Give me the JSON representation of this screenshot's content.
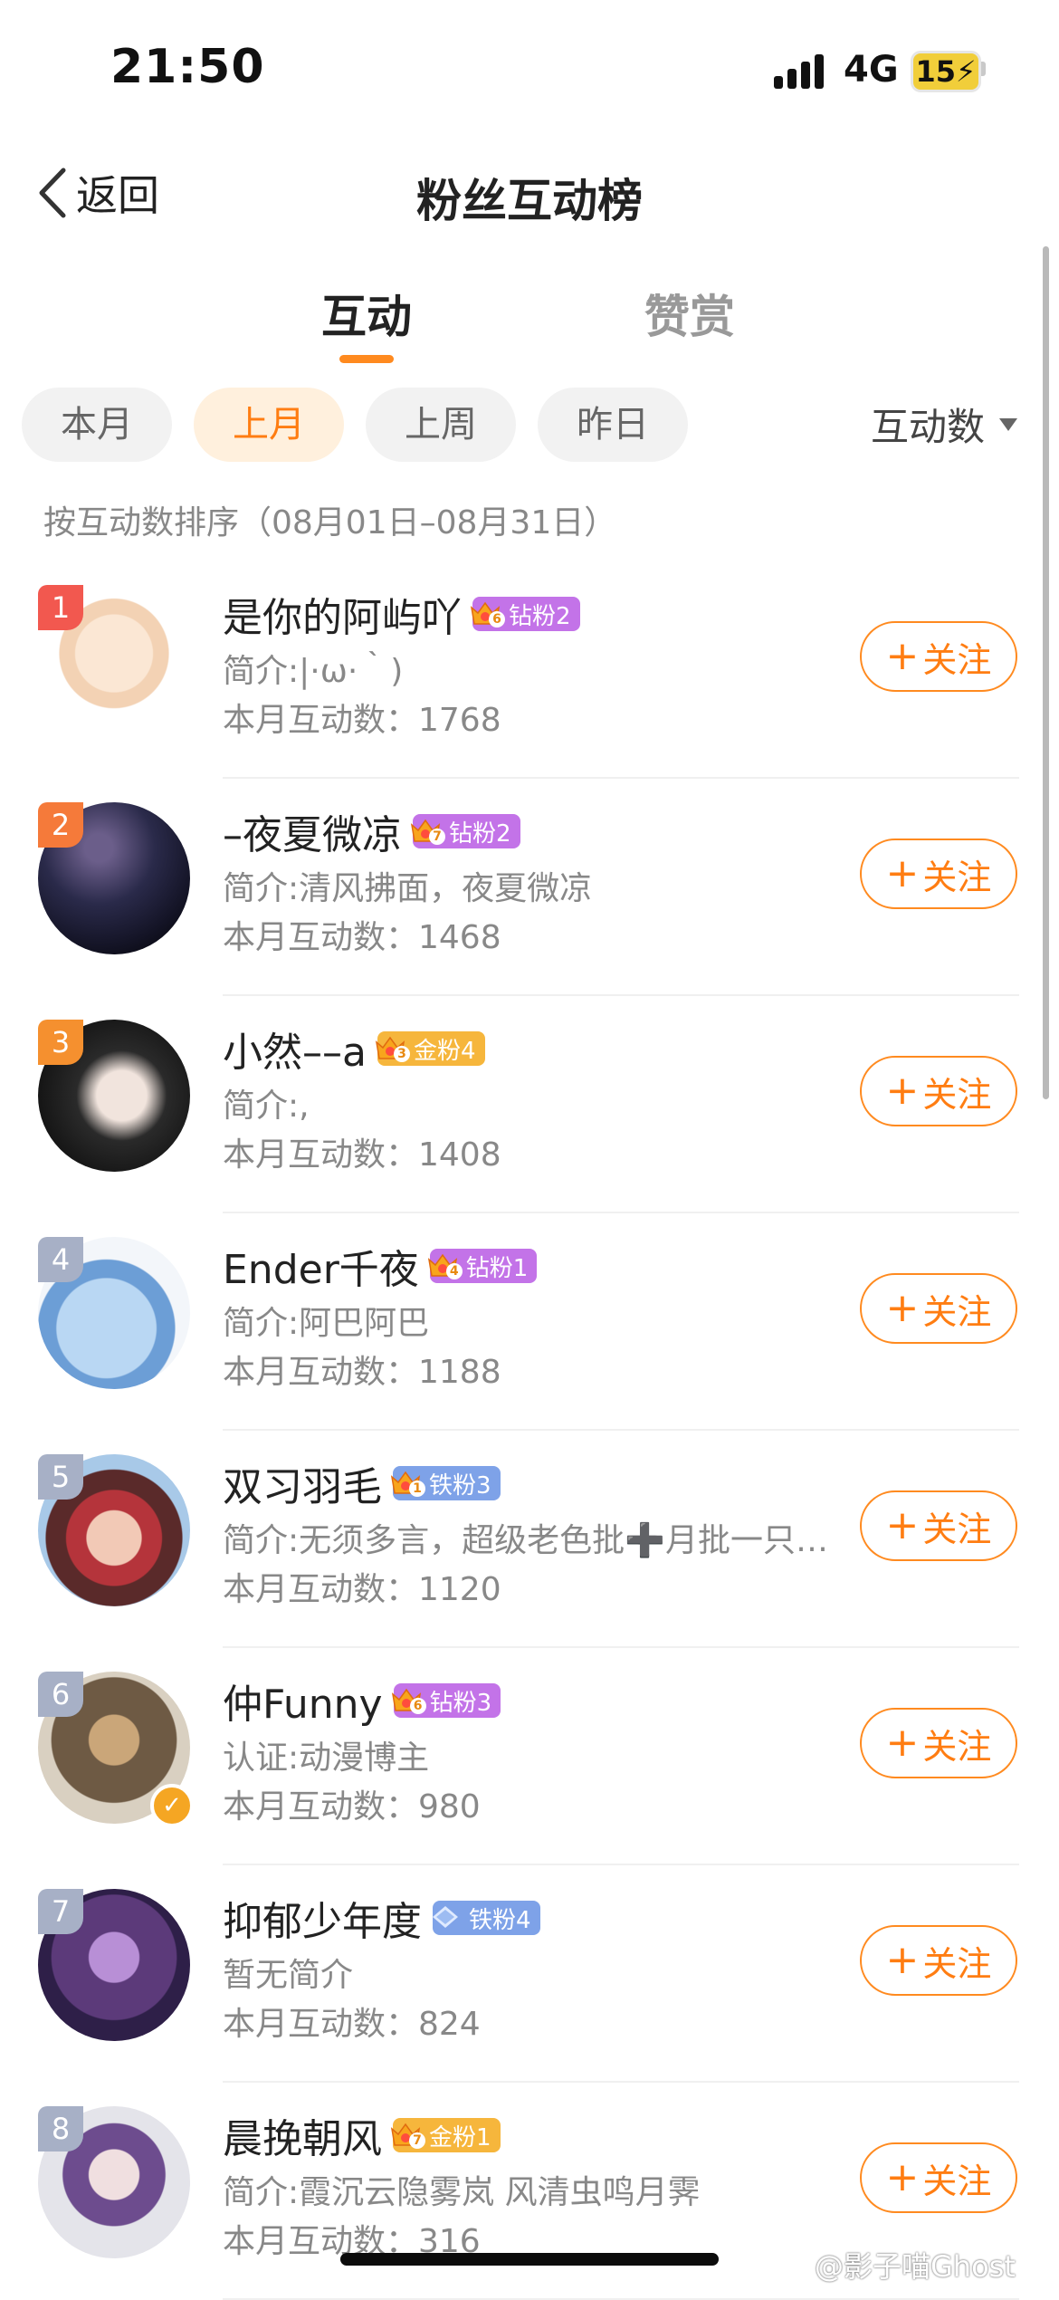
{
  "status_bar": {
    "time": "21:50",
    "network": "4G",
    "battery": "15"
  },
  "nav": {
    "back_label": "返回",
    "title": "粉丝互动榜"
  },
  "tabs": [
    {
      "label": "互动",
      "active": true
    },
    {
      "label": "赞赏",
      "active": false
    }
  ],
  "filters": {
    "chips": [
      {
        "label": "本月",
        "active": false
      },
      {
        "label": "上月",
        "active": true
      },
      {
        "label": "上周",
        "active": false
      },
      {
        "label": "昨日",
        "active": false
      }
    ],
    "sort_label": "互动数"
  },
  "sort_note": "按互动数排序（08月01日–08月31日）",
  "colors": {
    "accent": "#ff8a1f",
    "rank1": "#f2584f",
    "rank2": "#f57a3a",
    "rank3": "#f5902f",
    "rank_other": "#a7b0c6",
    "diamond_badge": "#c373e8",
    "gold_badge": "#f6b63c",
    "iron_badge": "#7ea2e8"
  },
  "follow_label": "关注",
  "fans": [
    {
      "rank": "1",
      "name": "是你的阿屿吖",
      "badge": "钻粉2",
      "badge_level": "6",
      "badge_type": "diamond",
      "bio": "简介:|·ω·｀)",
      "count": "本月互动数：1768",
      "avatar_icon": "anime-fox-girl-avatar",
      "verified": false
    },
    {
      "rank": "2",
      "name": "–夜夏微凉",
      "badge": "钻粉2",
      "badge_level": "7",
      "badge_type": "diamond",
      "bio": "简介:清风拂面，夜夏微凉",
      "count": "本月互动数：1468",
      "avatar_icon": "night-sky-avatar",
      "verified": false
    },
    {
      "rank": "3",
      "name": "小然––a",
      "badge": "金粉4",
      "badge_level": "3",
      "badge_type": "gold",
      "bio": "简介:,",
      "count": "本月互动数：1408",
      "avatar_icon": "portrait-avatar",
      "verified": false
    },
    {
      "rank": "4",
      "name": "Ender千夜",
      "badge": "钻粉1",
      "badge_level": "4",
      "badge_type": "diamond",
      "bio": "简介:阿巴阿巴",
      "count": "本月互动数：1188",
      "avatar_icon": "cartoon-shark-avatar",
      "verified": false
    },
    {
      "rank": "5",
      "name": "双习羽毛",
      "badge": "铁粉3",
      "badge_level": "1",
      "badge_type": "iron",
      "bio": "简介:无须多言，超级老色批➕月批一只…",
      "count": "本月互动数：1120",
      "avatar_icon": "anime-girl-avatar",
      "verified": false
    },
    {
      "rank": "6",
      "name": "仲Funny",
      "badge": "钻粉3",
      "badge_level": "6",
      "badge_type": "diamond",
      "bio": "认证:动漫博主",
      "count": "本月互动数：980",
      "avatar_icon": "hooded-character-avatar",
      "verified": true
    },
    {
      "rank": "7",
      "name": "抑郁少年度",
      "badge": "铁粉4",
      "badge_level": "",
      "badge_type": "iron_diamond",
      "bio": "暂无简介",
      "count": "本月互动数：824",
      "avatar_icon": "purple-anime-avatar",
      "verified": false
    },
    {
      "rank": "8",
      "name": "晨挽朝风",
      "badge": "金粉1",
      "badge_level": "7",
      "badge_type": "gold",
      "bio": "简介:霞沉云隐雾岚 风清虫鸣月霁",
      "count": "本月互动数：316",
      "avatar_icon": "anime-maid-avatar",
      "verified": false
    }
  ],
  "watermark": "@影子喵Ghost"
}
